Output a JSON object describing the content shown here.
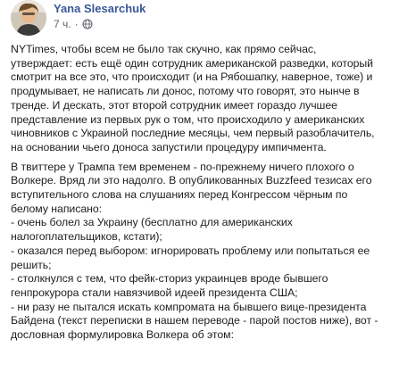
{
  "post": {
    "author": {
      "name": "Yana Slesarchuk"
    },
    "timestamp": "7 ч.",
    "separator": "·",
    "privacy_icon": "globe-icon",
    "paragraphs": [
      "NYTimes, чтобы всем не было так скучно, как прямо сейчас,\nутверждает: есть ещё один сотрудник американской разведки, который\nсмотрит на все это, что происходит (и на Рябошапку, наверное, тоже) и\nпродумывает, не написать ли донос, потому что говорят, это нынче в\nтренде. И дескать, этот второй сотрудник имеет гораздо лучшее\nпредставление из первых рук о том, что происходило у американских\nчиновников с Украиной последние месяцы, чем первый разоблачитель,\nна основании чьего доноса запустили процедуру импичмента.",
      "В твиттере у Трампа тем временем - по-прежнему ничего плохого о\nВолкере. Вряд ли это надолго. В опубликованных Buzzfeed тезисах его\nвступительного слова на слушаниях перед Конгрессом чёрным по\nбелому написано:\n- очень болел за Украину (бесплатно для американских\nналогоплательщиков, кстати);\n- оказался перед выбором: игнорировать проблему или попытаться ее\nрешить;\n- столкнулся с тем, что фейк-сториз украинцев вроде бывшего\nгенпрокурора стали навязчивой идеей президента США;\n- ни разу не пытался искать компромата на бывшего вице-президента\nБайдена (текст переписки в нашем переводе - парой постов ниже), вот -\nдословная формулировка Волкера об этом:"
    ]
  }
}
